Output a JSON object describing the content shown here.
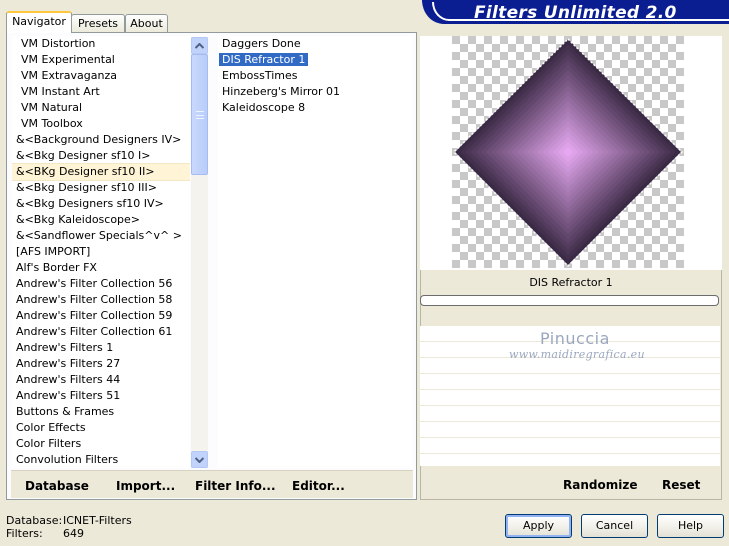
{
  "banner": {
    "title": "Filters Unlimited 2.0"
  },
  "tabs": [
    {
      "label": "Navigator",
      "active": true
    },
    {
      "label": "Presets",
      "active": false
    },
    {
      "label": "About",
      "active": false
    }
  ],
  "categories": [
    "VM Distortion",
    "VM Experimental",
    "VM Extravaganza",
    "VM Instant Art",
    "VM Natural",
    "VM Toolbox",
    "&<Background Designers IV>",
    "&<Bkg Designer sf10 I>",
    "&<BKg Designer sf10 II>",
    "&<Bkg Designer sf10 III>",
    "&<Bkg Designers sf10 IV>",
    "&<Bkg Kaleidoscope>",
    "&<Sandflower Specials^v^ >",
    "[AFS IMPORT]",
    "Alf's Border FX",
    "Andrew's Filter Collection 56",
    "Andrew's Filter Collection 58",
    "Andrew's Filter Collection 59",
    "Andrew's Filter Collection 61",
    "Andrew's Filters 1",
    "Andrew's Filters 27",
    "Andrew's Filters 44",
    "Andrew's Filters 51",
    "Buttons & Frames",
    "Color Effects",
    "Color Filters",
    "Convolution Filters"
  ],
  "selected_category": "&<BKg Designer sf10 II>",
  "filters": [
    "Daggers Done",
    "DIS Refractor 1",
    "EmbossTimes",
    "Hinzeberg's Mirror 01",
    "Kaleidoscope 8"
  ],
  "selected_filter": "DIS Refractor 1",
  "toolbar": {
    "database": "Database",
    "import": "Import...",
    "filter_info": "Filter Info...",
    "editor": "Editor..."
  },
  "preview": {
    "filter_name": "DIS Refractor 1",
    "progress": 0,
    "watermark_name": "Pinuccia",
    "watermark_url": "www.maidiregrafica.eu",
    "colors": {
      "outer": "#3b2a45",
      "inner": "#e5a8f0"
    }
  },
  "right_toolbar": {
    "randomize": "Randomize",
    "reset": "Reset"
  },
  "status": {
    "database_label": "Database:",
    "database_value": "ICNET-Filters",
    "filters_label": "Filters:",
    "filters_value": "649"
  },
  "buttons": {
    "apply": "Apply",
    "cancel": "Cancel",
    "help": "Help"
  }
}
